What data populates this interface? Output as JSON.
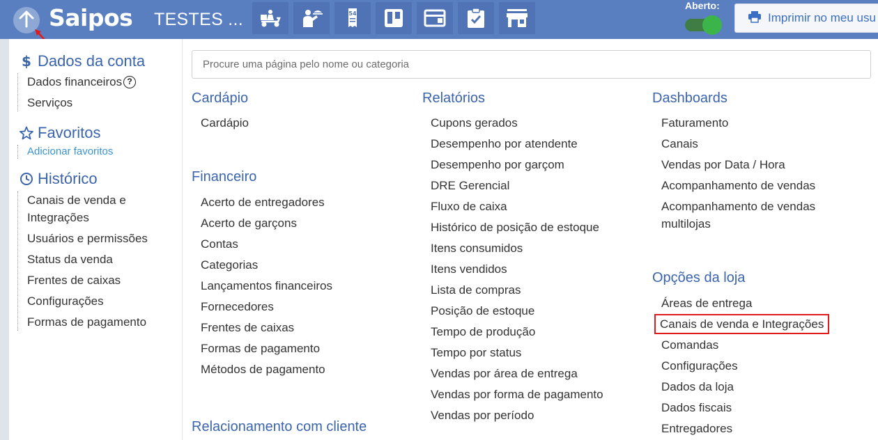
{
  "app": {
    "logo": "Saipos",
    "store_name": "TESTES ..."
  },
  "header": {
    "nav_icons": [
      "delivery-scooter-icon",
      "waiter-icon",
      "order-ticket-icon",
      "kanban-icon",
      "card-icon",
      "checklist-icon",
      "store-icon"
    ],
    "open_label": "Aberto:",
    "open_toggle": "on",
    "print_button": "Imprimir no meu usu",
    "colors": {
      "topbar": "#5a7fc1",
      "accent": "#3a64ac",
      "toggle_on": "#3bb54a",
      "highlight": "#e01b1b"
    }
  },
  "sidebar": {
    "account": {
      "title": "Dados da conta",
      "items": [
        "Dados financeiros",
        "Serviços"
      ]
    },
    "favorites": {
      "title": "Favoritos",
      "add_link": "Adicionar favoritos"
    },
    "history": {
      "title": "Histórico",
      "items": [
        "Canais de venda e Integrações",
        "Usuários e permissões",
        "Status da venda",
        "Frentes de caixas",
        "Configurações",
        "Formas de pagamento"
      ]
    }
  },
  "search": {
    "placeholder": "Procure uma página pelo nome ou categoria"
  },
  "groups": {
    "cardapio": {
      "title": "Cardápio",
      "items": [
        "Cardápio"
      ]
    },
    "financeiro": {
      "title": "Financeiro",
      "items": [
        "Acerto de entregadores",
        "Acerto de garçons",
        "Contas",
        "Categorias",
        "Lançamentos financeiros",
        "Fornecedores",
        "Frentes de caixas",
        "Formas de pagamento",
        "Métodos de pagamento"
      ]
    },
    "relacionamento": {
      "title": "Relacionamento com cliente"
    },
    "relatorios": {
      "title": "Relatórios",
      "items": [
        "Cupons gerados",
        "Desempenho por atendente",
        "Desempenho por garçom",
        "DRE Gerencial",
        "Fluxo de caixa",
        "Histórico de posição de estoque",
        "Itens consumidos",
        "Itens vendidos",
        "Lista de compras",
        "Posição de estoque",
        "Tempo de produção",
        "Tempo por status",
        "Vendas por área de entrega",
        "Vendas por forma de pagamento",
        "Vendas por período"
      ]
    },
    "dashboards": {
      "title": "Dashboards",
      "items": [
        "Faturamento",
        "Canais",
        "Vendas por Data / Hora",
        "Acompanhamento de vendas",
        "Acompanhamento de vendas multilojas"
      ]
    },
    "opcoes_loja": {
      "title": "Opções da loja",
      "items": [
        "Áreas de entrega",
        "Canais de venda e Integrações",
        "Comandas",
        "Configurações",
        "Dados da loja",
        "Dados fiscais",
        "Entregadores"
      ]
    }
  }
}
